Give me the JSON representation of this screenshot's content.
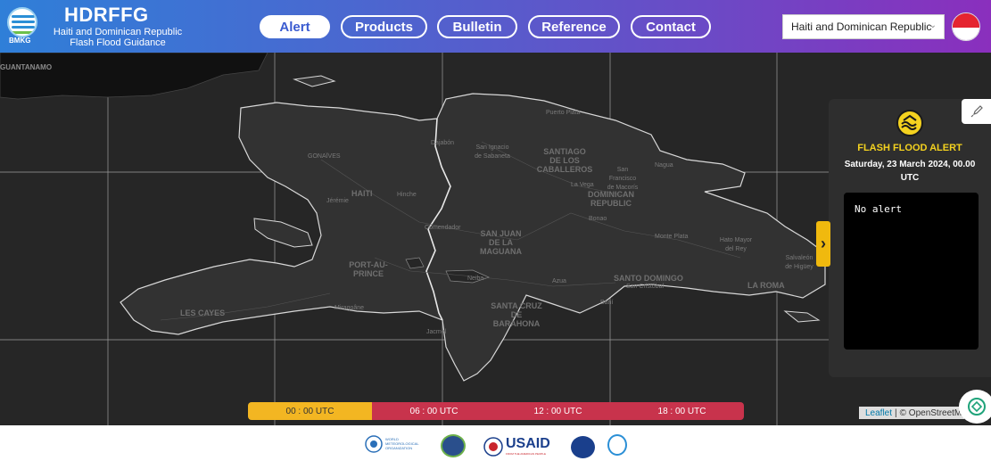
{
  "header": {
    "logo_text": "BMKG",
    "title": "HDRFFG",
    "subtitle_line1": "Haiti and Dominican Republic",
    "subtitle_line2": "Flash Flood Guidance"
  },
  "nav": {
    "alert": "Alert",
    "products": "Products",
    "bulletin": "Bulletin",
    "reference": "Reference",
    "contact": "Contact"
  },
  "region_select": {
    "selected": "Haiti and Dominican Republic"
  },
  "map_labels": {
    "guantanamo": "GUANTANAMO",
    "haiti": "HAITI",
    "dominican_republic_1": "DOMINICAN",
    "dominican_republic_2": "REPUBLIC",
    "port_au_prince_1": "PORT-AU-",
    "port_au_prince_2": "PRINCE",
    "santiago_1": "SANTIAGO",
    "santiago_2": "DE LOS CABALLEROS",
    "san_juan_1": "SAN JUAN",
    "san_juan_2": "DE LA MAGUANA",
    "santo_domingo": "SANTO DOMINGO",
    "santa_cruz_1": "SANTA CRUZ",
    "santa_cruz_2": "DE BARAHONA",
    "les_cayes": "LES CAYES",
    "la_romana": "LA ROMA",
    "gonaives": "GONAÏVES",
    "hinche": "Hinche",
    "jeremie": "Jérémie",
    "neiba": "Neiba",
    "azua": "Azua",
    "bani": "Baní",
    "la_vega": "La Vega",
    "bonao": "Bonao",
    "monte_plata": "Monte Plata",
    "hato_mayor": "Hato Mayor del Rey",
    "salvaleon": "Salvaleón de Higüey",
    "san_francisco": "San Francisco de Macorís",
    "dajabon": "Dajabón",
    "puerto_plata": "Puerto Plata",
    "comendador": "Comendador",
    "san_ignacio": "San Ignacio de Sabaneta",
    "nagua": "Nagua",
    "san_cristobal": "San Cristóbal",
    "miragoane": "Miragoâne",
    "jacmel": "Jacmel"
  },
  "alert_panel": {
    "title": "FLASH FLOOD ALERT",
    "date": "Saturday, 23 March 2024, 00.00 UTC",
    "content": "No alert",
    "toggle_symbol": "›"
  },
  "timeline": [
    {
      "label": "00 : 00 UTC",
      "active": true
    },
    {
      "label": "06 : 00 UTC",
      "active": false
    },
    {
      "label": "12 : 00 UTC",
      "active": false
    },
    {
      "label": "18 : 00 UTC",
      "active": false
    }
  ],
  "attribution": {
    "leaflet": "Leaflet",
    "separator": "|",
    "osm": "© OpenStreetMap"
  },
  "footer": {
    "partners": [
      "WMO",
      "HRC",
      "USAID",
      "NOAA",
      "BMKG"
    ],
    "usaid_text": "USAID",
    "usaid_sub": "FROM THE AMERICAN PEOPLE",
    "wmo_text_1": "WORLD",
    "wmo_text_2": "METEOROLOGICAL",
    "wmo_text_3": "ORGANIZATION"
  },
  "colors": {
    "header_start": "#2f7fd8",
    "header_end": "#8a2fbd",
    "map_bg": "#262626",
    "alert_yellow": "#f4d21f",
    "timeline_active": "#f3b622",
    "timeline_inactive": "#c8334c"
  },
  "icons": {
    "logo": "bmkg-logo-icon",
    "flag": "indonesia-flag-icon",
    "alert": "flood-wave-icon",
    "rocket": "rocket-icon",
    "chat": "openai-chat-icon"
  }
}
